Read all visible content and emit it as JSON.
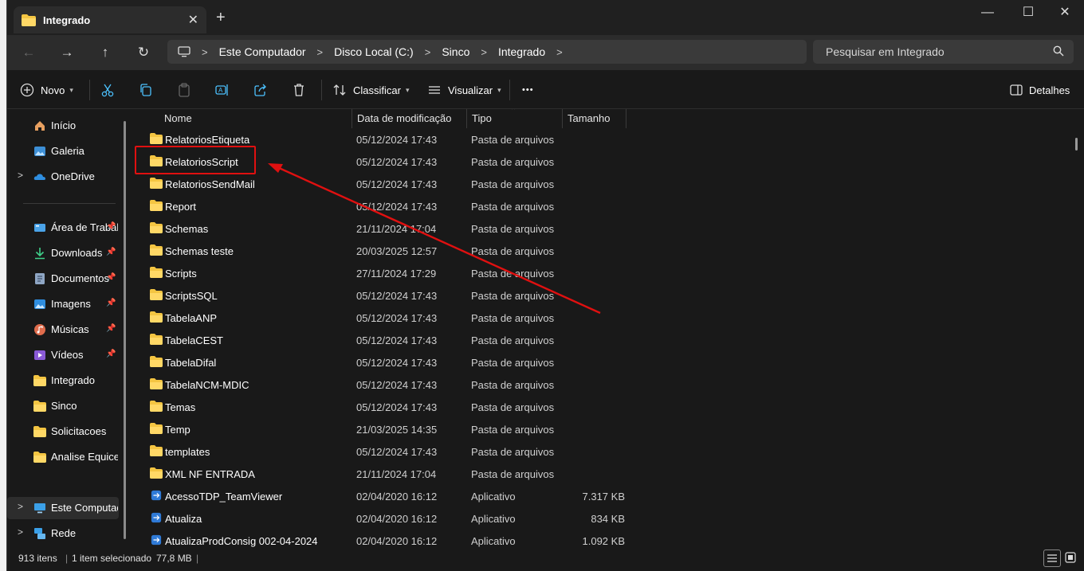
{
  "window": {
    "tab_title": "Integrado",
    "newtab_glyph": "+"
  },
  "nav": {
    "breadcrumb": [
      "Este Computador",
      "Disco Local (C:)",
      "Sinco",
      "Integrado"
    ],
    "search_placeholder": "Pesquisar em Integrado"
  },
  "toolbar": {
    "new_label": "Novo",
    "sort_label": "Classificar",
    "view_label": "Visualizar",
    "more_label": "•••",
    "details_label": "Detalhes"
  },
  "sidebar": {
    "items": [
      {
        "label": "Início",
        "icon": "home-icon"
      },
      {
        "label": "Galeria",
        "icon": "gallery-icon"
      },
      {
        "label": "OneDrive",
        "icon": "cloud-icon"
      },
      {
        "label": "Área de Trabalho",
        "icon": "desktop-icon"
      },
      {
        "label": "Downloads",
        "icon": "download-icon"
      },
      {
        "label": "Documentos",
        "icon": "document-icon"
      },
      {
        "label": "Imagens",
        "icon": "image-icon"
      },
      {
        "label": "Músicas",
        "icon": "music-icon"
      },
      {
        "label": "Vídeos",
        "icon": "video-icon"
      },
      {
        "label": "Integrado",
        "icon": "folder-icon"
      },
      {
        "label": "Sinco",
        "icon": "folder-icon"
      },
      {
        "label": "Solicitacoes",
        "icon": "folder-icon"
      },
      {
        "label": "Analise Equicenter",
        "icon": "folder-icon"
      },
      {
        "label": "Este Computador",
        "icon": "computer-icon"
      },
      {
        "label": "Rede",
        "icon": "network-icon"
      }
    ]
  },
  "columns": {
    "name": "Nome",
    "date": "Data de modificação",
    "type": "Tipo",
    "size": "Tamanho"
  },
  "files": [
    {
      "name": "RelatoriosEtiqueta",
      "date": "05/12/2024 17:43",
      "type": "Pasta de arquivos",
      "size": ""
    },
    {
      "name": "RelatoriosScript",
      "date": "05/12/2024 17:43",
      "type": "Pasta de arquivos",
      "size": ""
    },
    {
      "name": "RelatoriosSendMail",
      "date": "05/12/2024 17:43",
      "type": "Pasta de arquivos",
      "size": ""
    },
    {
      "name": "Report",
      "date": "05/12/2024 17:43",
      "type": "Pasta de arquivos",
      "size": ""
    },
    {
      "name": "Schemas",
      "date": "21/11/2024 17:04",
      "type": "Pasta de arquivos",
      "size": ""
    },
    {
      "name": "Schemas teste",
      "date": "20/03/2025 12:57",
      "type": "Pasta de arquivos",
      "size": ""
    },
    {
      "name": "Scripts",
      "date": "27/11/2024 17:29",
      "type": "Pasta de arquivos",
      "size": ""
    },
    {
      "name": "ScriptsSQL",
      "date": "05/12/2024 17:43",
      "type": "Pasta de arquivos",
      "size": ""
    },
    {
      "name": "TabelaANP",
      "date": "05/12/2024 17:43",
      "type": "Pasta de arquivos",
      "size": ""
    },
    {
      "name": "TabelaCEST",
      "date": "05/12/2024 17:43",
      "type": "Pasta de arquivos",
      "size": ""
    },
    {
      "name": "TabelaDifal",
      "date": "05/12/2024 17:43",
      "type": "Pasta de arquivos",
      "size": ""
    },
    {
      "name": "TabelaNCM-MDIC",
      "date": "05/12/2024 17:43",
      "type": "Pasta de arquivos",
      "size": ""
    },
    {
      "name": "Temas",
      "date": "05/12/2024 17:43",
      "type": "Pasta de arquivos",
      "size": ""
    },
    {
      "name": "Temp",
      "date": "21/03/2025 14:35",
      "type": "Pasta de arquivos",
      "size": ""
    },
    {
      "name": "templates",
      "date": "05/12/2024 17:43",
      "type": "Pasta de arquivos",
      "size": ""
    },
    {
      "name": "XML NF ENTRADA",
      "date": "21/11/2024 17:04",
      "type": "Pasta de arquivos",
      "size": ""
    },
    {
      "name": "AcessoTDP_TeamViewer",
      "date": "02/04/2020 16:12",
      "type": "Aplicativo",
      "size": "7.317 KB"
    },
    {
      "name": "Atualiza",
      "date": "02/04/2020 16:12",
      "type": "Aplicativo",
      "size": "834 KB"
    },
    {
      "name": "AtualizaProdConsig 002-04-2024",
      "date": "02/04/2020 16:12",
      "type": "Aplicativo",
      "size": "1.092 KB"
    }
  ],
  "status": {
    "count": "913 itens",
    "selected": "1 item selecionado",
    "size": "77,8 MB"
  },
  "annotation": {
    "highlight_color": "#e01010"
  },
  "colors": {
    "folder": "#f4c542",
    "accent": "#4cc2ff"
  }
}
